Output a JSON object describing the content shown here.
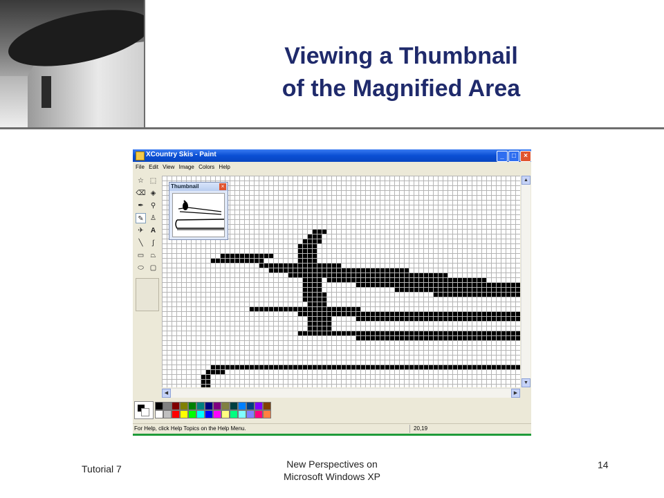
{
  "slide": {
    "title_line1": "Viewing a Thumbnail",
    "title_line2": "of the Magnified Area",
    "footer_left": "Tutorial 7",
    "footer_center_line1": "New Perspectives on",
    "footer_center_line2": "Microsoft Windows XP",
    "page_number": "14"
  },
  "window": {
    "title": "XCountry Skis - Paint",
    "menu": [
      "File",
      "Edit",
      "View",
      "Image",
      "Colors",
      "Help"
    ],
    "thumbnail_title": "Thumbnail",
    "status_help": "For Help, click Help Topics on the Help Menu.",
    "status_coords": "20,19"
  },
  "colors": {
    "title_text": "#1f2a6b",
    "xp_titlebar": "#0a4fd4",
    "status_accent": "#1f9b3a"
  },
  "palette": {
    "row1": [
      "#000000",
      "#808080",
      "#800000",
      "#808000",
      "#008000",
      "#008080",
      "#000080",
      "#800080",
      "#808040",
      "#004040",
      "#0080ff",
      "#004080",
      "#8000ff",
      "#804000"
    ],
    "row2": [
      "#ffffff",
      "#c0c0c0",
      "#ff0000",
      "#ffff00",
      "#00ff00",
      "#00ffff",
      "#0000ff",
      "#ff00ff",
      "#ffff80",
      "#00ff80",
      "#80ffff",
      "#8080ff",
      "#ff0080",
      "#ff8040"
    ]
  }
}
